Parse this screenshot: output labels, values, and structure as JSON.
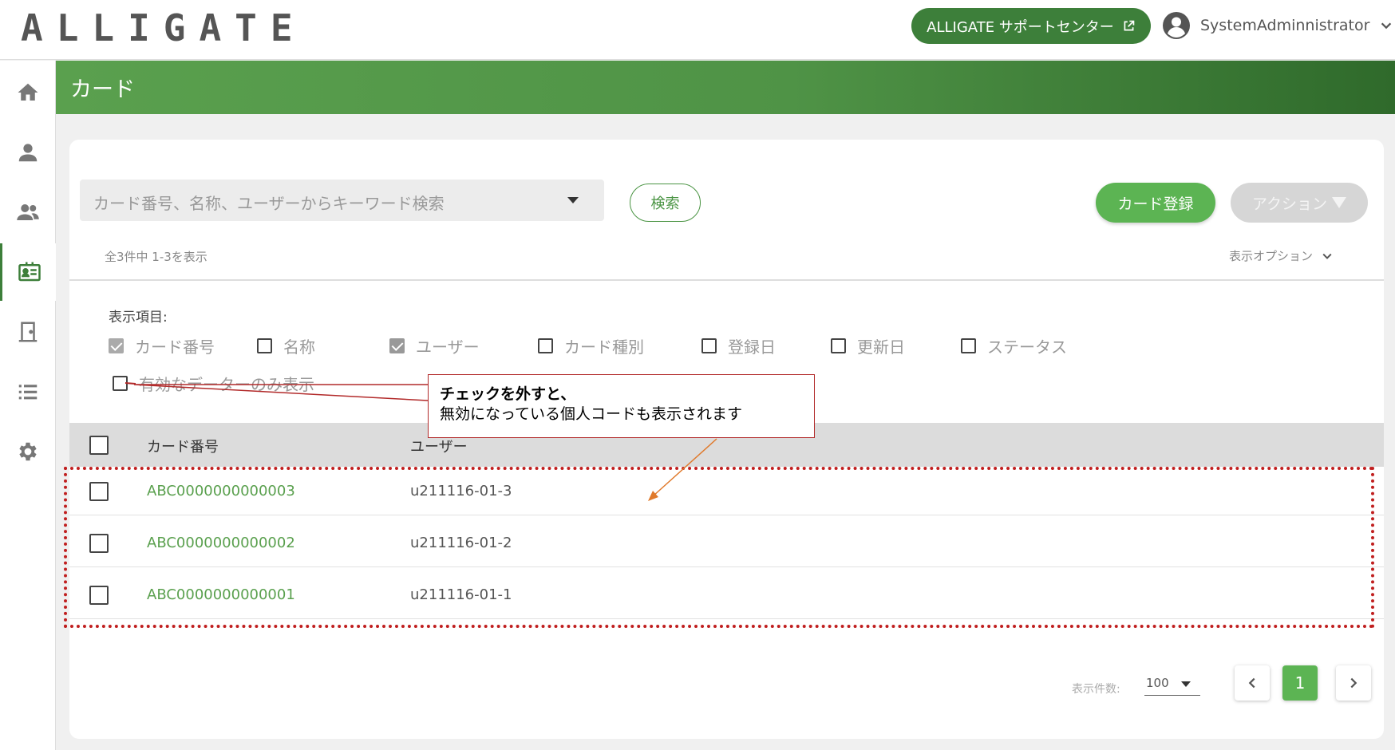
{
  "header": {
    "logo": "ALLIGATE",
    "support_label": "ALLIGATE サポートセンター",
    "username": "SystemAdminnistrator"
  },
  "sidebar": {
    "items": [
      {
        "icon": "home-icon"
      },
      {
        "icon": "user-icon"
      },
      {
        "icon": "users-icon"
      },
      {
        "icon": "card-icon",
        "active": true
      },
      {
        "icon": "door-icon"
      },
      {
        "icon": "list-icon"
      },
      {
        "icon": "gear-icon"
      }
    ]
  },
  "page": {
    "title": "カード"
  },
  "toolbar": {
    "search_placeholder": "カード番号、名称、ユーザーからキーワード検索",
    "search_label": "検索",
    "register_label": "カード登録",
    "action_label": "アクション"
  },
  "summary": {
    "count_text": "全3件中 1-3を表示",
    "display_options_label": "表示オプション"
  },
  "display_items": {
    "label": "表示項目:",
    "options": [
      {
        "label": "カード番号",
        "checked": true,
        "disabled": true
      },
      {
        "label": "名称",
        "checked": false
      },
      {
        "label": "ユーザー",
        "checked": true
      },
      {
        "label": "カード種別",
        "checked": false
      },
      {
        "label": "登録日",
        "checked": false
      },
      {
        "label": "更新日",
        "checked": false
      },
      {
        "label": "ステータス",
        "checked": false
      }
    ],
    "valid_only_label": "有効なデーターのみ表示"
  },
  "table": {
    "columns": [
      "カード番号",
      "ユーザー"
    ],
    "rows": [
      {
        "card_no": "ABC0000000000003",
        "user": "u211116-01-3"
      },
      {
        "card_no": "ABC0000000000002",
        "user": "u211116-01-2"
      },
      {
        "card_no": "ABC0000000000001",
        "user": "u211116-01-1"
      }
    ]
  },
  "annotation": {
    "line1": "チェックを外すと、",
    "line2": "無効になっている個人コードも表示されます",
    "box_color": "#c01f1f",
    "arrow_color": "#e07a2c"
  },
  "pagination": {
    "per_page_label": "表示件数:",
    "per_page_value": "100",
    "current_page": "1"
  },
  "colors": {
    "brand_green": "#3d7f3a",
    "accent_green": "#5cb453",
    "link_green": "#5aa04e"
  }
}
